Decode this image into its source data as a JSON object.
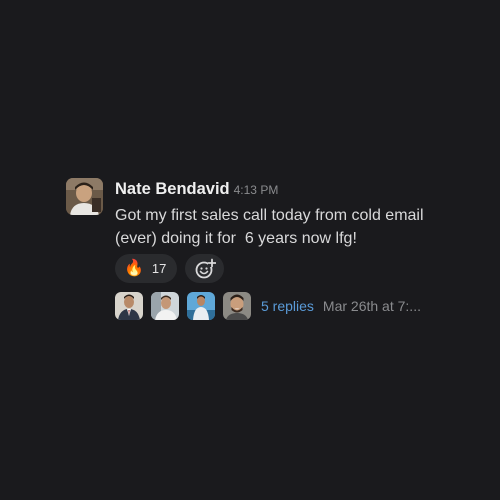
{
  "message": {
    "sender": "Nate Bendavid",
    "timestamp": "4:13 PM",
    "text": "Got my first sales call today from cold email (ever) doing it for  6 years now lfg!",
    "reactions": [
      {
        "emoji": "🔥",
        "emoji_name": "fire-emoji",
        "count": "17"
      }
    ],
    "add_reaction_icon": "add-reaction-smiley-icon",
    "thread": {
      "participants": [
        "participant-1",
        "participant-2",
        "participant-3",
        "participant-4"
      ],
      "replies_label": "5 replies",
      "last_reply": "Mar 26th at 7:..."
    }
  },
  "colors": {
    "background": "#1a1a1d",
    "link": "#5a9bd8",
    "pill": "#2a2b2e"
  }
}
